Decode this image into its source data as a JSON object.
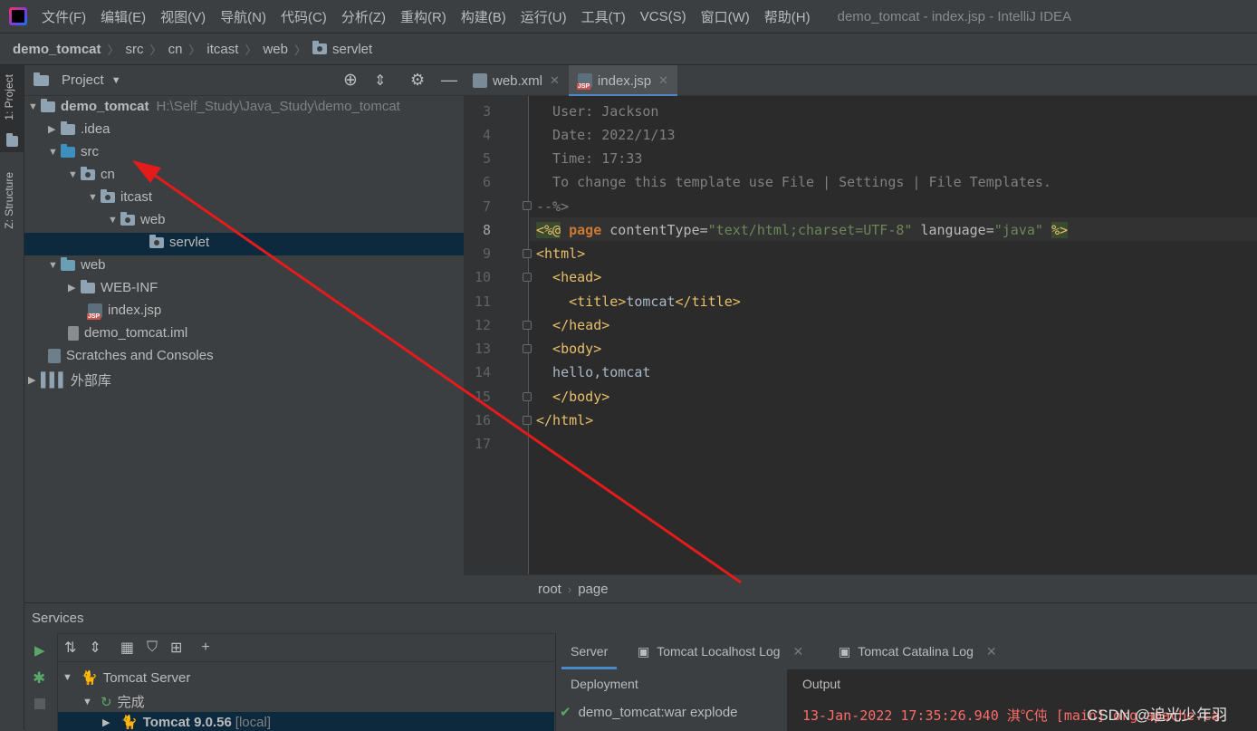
{
  "menubar": {
    "items": [
      "文件(F)",
      "编辑(E)",
      "视图(V)",
      "导航(N)",
      "代码(C)",
      "分析(Z)",
      "重构(R)",
      "构建(B)",
      "运行(U)",
      "工具(T)",
      "VCS(S)",
      "窗口(W)",
      "帮助(H)"
    ],
    "window_title": "demo_tomcat - index.jsp - IntelliJ IDEA"
  },
  "breadcrumb": [
    "demo_tomcat",
    "src",
    "cn",
    "itcast",
    "web",
    "servlet"
  ],
  "left_strip": {
    "project_tab": "1: Project",
    "structure_tab": "Z: Structure"
  },
  "project_panel": {
    "title": "Project",
    "root_name": "demo_tomcat",
    "root_path": "H:\\Self_Study\\Java_Study\\demo_tomcat",
    "items": [
      ".idea",
      "src",
      "cn",
      "itcast",
      "web",
      "servlet",
      "web",
      "WEB-INF",
      "index.jsp",
      "demo_tomcat.iml",
      "Scratches and Consoles",
      "外部库"
    ]
  },
  "editor": {
    "tabs": [
      "web.xml",
      "index.jsp"
    ],
    "line_numbers": [
      "3",
      "4",
      "5",
      "6",
      "7",
      "8",
      "9",
      "10",
      "11",
      "12",
      "13",
      "14",
      "15",
      "16",
      "17"
    ],
    "comment_lines": [
      "  User: Jackson",
      "  Date: 2022/1/13",
      "  Time: 17:33",
      "  To change this template use File | Settings | File Templates.",
      "--%>"
    ],
    "directive": {
      "open": "<%@",
      "kw": " page ",
      "a1": "contentType=",
      "v1": "\"text/html;charset=UTF-8\"",
      "a2": " language=",
      "v2": "\"java\"",
      "close": "%>"
    },
    "code": {
      "html_open": "<html>",
      "head_open": "  <head>",
      "title_open": "    <title>",
      "title_text": "tomcat",
      "title_close": "</title>",
      "head_close": "  </head>",
      "body_open": "  <body>",
      "body_text": "  hello,tomcat",
      "body_close": "  </body>",
      "html_close": "</html>"
    },
    "breadcrumbs": [
      "root",
      "page"
    ]
  },
  "services": {
    "title": "Services",
    "tree": {
      "server": "Tomcat Server",
      "group": "完成",
      "instance": "Tomcat 9.0.56",
      "instance_suffix": "[local]"
    },
    "tabs": [
      "Server",
      "Tomcat Localhost Log",
      "Tomcat Catalina Log"
    ],
    "deployment_header": "Deployment",
    "output_header": "Output",
    "deployment_item": "demo_tomcat:war explode",
    "output_line": "13-Jan-2022 17:35:26.940 淇℃伅 [main] org.apache.ca",
    "watermark": "CSDN @追光少年羽"
  },
  "colors": {
    "accent": "#4a88c7",
    "annotation_arrow": "#e31b1b"
  }
}
